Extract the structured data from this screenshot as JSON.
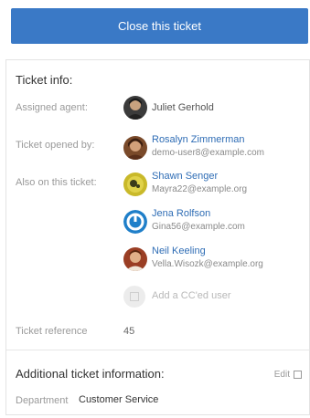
{
  "actions": {
    "close_ticket_label": "Close this ticket"
  },
  "ticket_info": {
    "title": "Ticket info:",
    "assigned_agent_label": "Assigned agent:",
    "assigned_agent": {
      "name": "Juliet Gerhold"
    },
    "opened_by_label": "Ticket opened by:",
    "opened_by": {
      "name": "Rosalyn Zimmerman",
      "email": "demo-user8@example.com"
    },
    "also_on_label": "Also on this ticket:",
    "also_on": [
      {
        "name": "Shawn Senger",
        "email": "Mayra22@example.org"
      },
      {
        "name": "Jena Rolfson",
        "email": "Gina56@example.com"
      },
      {
        "name": "Neil Keeling",
        "email": "Vella.Wisozk@example.org"
      }
    ],
    "add_cc_placeholder": "Add a CC'ed user",
    "reference_label": "Ticket reference",
    "reference_value": "45"
  },
  "additional_info": {
    "title": "Additional ticket information:",
    "edit_label": "Edit",
    "department_label": "Department",
    "department_value": "Customer Service"
  },
  "colors": {
    "primary_button": "#3a79c6",
    "link": "#2f6db5"
  }
}
